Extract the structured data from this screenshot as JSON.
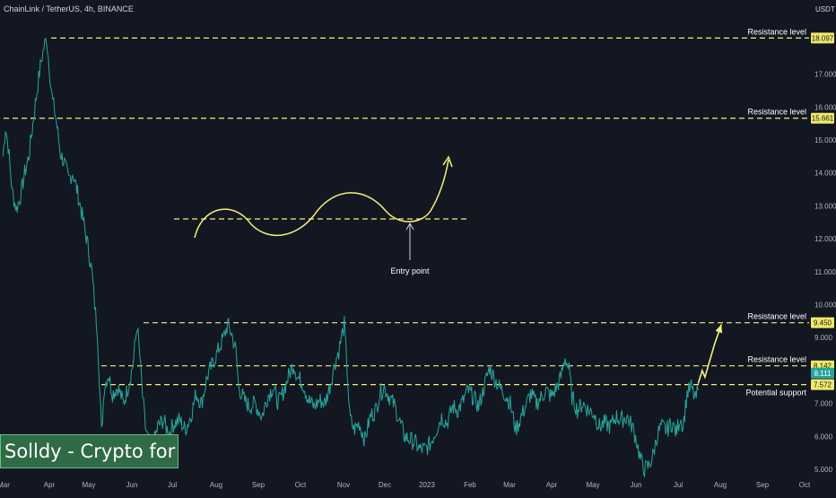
{
  "header": {
    "symbol_text": "ChainLink / TetherUS, 4h, BINANCE",
    "currency": "USDT"
  },
  "watermark": {
    "text": "Solldy - Crypto for U"
  },
  "colors": {
    "background": "#131722",
    "price_line": "#26a69a",
    "annotation": "#f5f07a",
    "axis_text": "#b2b5be",
    "label_text": "#ffffff"
  },
  "chart_data": {
    "type": "line",
    "title": "ChainLink / TetherUS, 4h, BINANCE",
    "ylabel": "USDT",
    "ylim": [
      4.8,
      18.9
    ],
    "y_ticks": [
      "5.000",
      "6.000",
      "7.000",
      "8.000",
      "9.000",
      "10.000",
      "11.000",
      "12.000",
      "13.000",
      "14.000",
      "15.000",
      "16.000",
      "17.000"
    ],
    "x_ticks": [
      "Mar",
      "Apr",
      "May",
      "Jun",
      "Jul",
      "Aug",
      "Sep",
      "Oct",
      "Nov",
      "Dec",
      "2023",
      "Feb",
      "Mar",
      "Apr",
      "May",
      "Jun",
      "Jul",
      "Aug",
      "Sep",
      "Oct"
    ],
    "series": [
      {
        "values": [
          [
            "2022-03-01",
            14.5
          ],
          [
            "2022-03-03",
            15.4
          ],
          [
            "2022-03-05",
            14.8
          ],
          [
            "2022-03-08",
            13.4
          ],
          [
            "2022-03-11",
            12.9
          ],
          [
            "2022-03-14",
            13.3
          ],
          [
            "2022-03-17",
            14.0
          ],
          [
            "2022-03-20",
            14.5
          ],
          [
            "2022-03-23",
            15.5
          ],
          [
            "2022-03-26",
            16.5
          ],
          [
            "2022-03-29",
            17.4
          ],
          [
            "2022-03-31",
            17.8
          ],
          [
            "2022-04-02",
            18.1
          ],
          [
            "2022-04-04",
            17.2
          ],
          [
            "2022-04-06",
            16.3
          ],
          [
            "2022-04-09",
            15.6
          ],
          [
            "2022-04-12",
            14.6
          ],
          [
            "2022-04-15",
            14.3
          ],
          [
            "2022-04-18",
            13.8
          ],
          [
            "2022-04-21",
            14.0
          ],
          [
            "2022-04-24",
            13.5
          ],
          [
            "2022-04-28",
            12.7
          ],
          [
            "2022-05-02",
            11.8
          ],
          [
            "2022-05-05",
            11.0
          ],
          [
            "2022-05-07",
            10.0
          ],
          [
            "2022-05-09",
            9.2
          ],
          [
            "2022-05-11",
            7.2
          ],
          [
            "2022-05-12",
            6.1
          ],
          [
            "2022-05-14",
            7.5
          ],
          [
            "2022-05-17",
            7.9
          ],
          [
            "2022-05-20",
            7.3
          ],
          [
            "2022-05-24",
            7.5
          ],
          [
            "2022-05-28",
            7.0
          ],
          [
            "2022-06-01",
            7.6
          ],
          [
            "2022-06-04",
            8.2
          ],
          [
            "2022-06-07",
            9.4
          ],
          [
            "2022-06-09",
            8.4
          ],
          [
            "2022-06-11",
            7.2
          ],
          [
            "2022-06-13",
            6.3
          ],
          [
            "2022-06-15",
            5.9
          ],
          [
            "2022-06-18",
            5.6
          ],
          [
            "2022-06-22",
            6.3
          ],
          [
            "2022-06-26",
            6.5
          ],
          [
            "2022-06-30",
            6.1
          ],
          [
            "2022-07-04",
            6.4
          ],
          [
            "2022-07-08",
            6.5
          ],
          [
            "2022-07-12",
            6.2
          ],
          [
            "2022-07-16",
            6.6
          ],
          [
            "2022-07-20",
            7.3
          ],
          [
            "2022-07-24",
            7.0
          ],
          [
            "2022-07-28",
            7.8
          ],
          [
            "2022-08-01",
            8.2
          ],
          [
            "2022-08-05",
            8.6
          ],
          [
            "2022-08-09",
            9.0
          ],
          [
            "2022-08-12",
            9.4
          ],
          [
            "2022-08-15",
            9.1
          ],
          [
            "2022-08-18",
            8.6
          ],
          [
            "2022-08-20",
            7.5
          ],
          [
            "2022-08-24",
            7.1
          ],
          [
            "2022-08-28",
            6.9
          ],
          [
            "2022-09-01",
            7.0
          ],
          [
            "2022-09-06",
            6.6
          ],
          [
            "2022-09-10",
            7.2
          ],
          [
            "2022-09-14",
            7.5
          ],
          [
            "2022-09-18",
            7.0
          ],
          [
            "2022-09-22",
            7.4
          ],
          [
            "2022-09-26",
            7.9
          ],
          [
            "2022-09-29",
            8.2
          ],
          [
            "2022-10-02",
            7.8
          ],
          [
            "2022-10-06",
            7.6
          ],
          [
            "2022-10-10",
            7.1
          ],
          [
            "2022-10-14",
            6.9
          ],
          [
            "2022-10-18",
            7.1
          ],
          [
            "2022-10-22",
            7.0
          ],
          [
            "2022-10-26",
            7.6
          ],
          [
            "2022-10-29",
            8.2
          ],
          [
            "2022-11-01",
            8.6
          ],
          [
            "2022-11-03",
            9.0
          ],
          [
            "2022-11-05",
            9.4
          ],
          [
            "2022-11-07",
            8.1
          ],
          [
            "2022-11-09",
            6.6
          ],
          [
            "2022-11-12",
            6.2
          ],
          [
            "2022-11-16",
            6.4
          ],
          [
            "2022-11-20",
            5.9
          ],
          [
            "2022-11-24",
            6.6
          ],
          [
            "2022-11-28",
            6.8
          ],
          [
            "2022-12-01",
            7.3
          ],
          [
            "2022-12-04",
            7.5
          ],
          [
            "2022-12-08",
            7.2
          ],
          [
            "2022-12-12",
            6.9
          ],
          [
            "2022-12-15",
            6.5
          ],
          [
            "2022-12-19",
            6.0
          ],
          [
            "2022-12-23",
            5.9
          ],
          [
            "2022-12-27",
            5.8
          ],
          [
            "2022-12-30",
            5.6
          ],
          [
            "2023-01-03",
            5.6
          ],
          [
            "2023-01-07",
            5.8
          ],
          [
            "2023-01-11",
            6.2
          ],
          [
            "2023-01-15",
            6.6
          ],
          [
            "2023-01-19",
            6.4
          ],
          [
            "2023-01-23",
            6.9
          ],
          [
            "2023-01-27",
            6.8
          ],
          [
            "2023-01-31",
            7.1
          ],
          [
            "2023-02-03",
            7.4
          ],
          [
            "2023-02-07",
            7.2
          ],
          [
            "2023-02-11",
            6.9
          ],
          [
            "2023-02-15",
            7.5
          ],
          [
            "2023-02-19",
            8.1
          ],
          [
            "2023-02-22",
            7.8
          ],
          [
            "2023-02-26",
            7.5
          ],
          [
            "2023-03-02",
            7.3
          ],
          [
            "2023-03-06",
            7.0
          ],
          [
            "2023-03-10",
            6.2
          ],
          [
            "2023-03-13",
            6.5
          ],
          [
            "2023-03-17",
            6.9
          ],
          [
            "2023-03-21",
            7.3
          ],
          [
            "2023-03-25",
            7.0
          ],
          [
            "2023-03-29",
            7.2
          ],
          [
            "2023-04-01",
            7.4
          ],
          [
            "2023-04-05",
            7.2
          ],
          [
            "2023-04-09",
            7.5
          ],
          [
            "2023-04-12",
            7.8
          ],
          [
            "2023-04-15",
            8.4
          ],
          [
            "2023-04-18",
            8.0
          ],
          [
            "2023-04-20",
            7.2
          ],
          [
            "2023-04-24",
            6.8
          ],
          [
            "2023-04-28",
            7.0
          ],
          [
            "2023-05-02",
            6.8
          ],
          [
            "2023-05-06",
            6.7
          ],
          [
            "2023-05-10",
            6.3
          ],
          [
            "2023-05-14",
            6.4
          ],
          [
            "2023-05-18",
            6.3
          ],
          [
            "2023-05-22",
            6.6
          ],
          [
            "2023-05-26",
            6.5
          ],
          [
            "2023-05-30",
            6.6
          ],
          [
            "2023-06-03",
            6.3
          ],
          [
            "2023-06-06",
            5.9
          ],
          [
            "2023-06-09",
            5.3
          ],
          [
            "2023-06-12",
            5.0
          ],
          [
            "2023-06-15",
            5.1
          ],
          [
            "2023-06-18",
            5.4
          ],
          [
            "2023-06-21",
            6.0
          ],
          [
            "2023-06-24",
            6.3
          ],
          [
            "2023-06-28",
            6.2
          ],
          [
            "2023-07-02",
            6.4
          ],
          [
            "2023-07-05",
            6.1
          ],
          [
            "2023-07-08",
            6.6
          ],
          [
            "2023-07-10",
            6.3
          ],
          [
            "2023-07-13",
            7.3
          ],
          [
            "2023-07-16",
            7.5
          ],
          [
            "2023-07-19",
            7.1
          ],
          [
            "2023-07-21",
            7.4
          ]
        ]
      }
    ],
    "horizontal_levels": [
      {
        "label": "Resistance level",
        "value": 18.097,
        "tag": "18.097"
      },
      {
        "label": "Resistance level",
        "value": 15.661,
        "tag": "15.661"
      },
      {
        "label": "Resistance level",
        "value": 9.45,
        "tag": "9.450"
      },
      {
        "label": "Resistance level",
        "value": 8.142,
        "tag": "8.142"
      },
      {
        "label": "Potential support",
        "value": 7.572,
        "tag": "7.572"
      }
    ],
    "current_price_tag": "8.111",
    "annotations": [
      {
        "text": "Entry point"
      }
    ],
    "projection_path": [
      [
        "2023-07-21",
        7.6
      ],
      [
        "2023-07-24",
        8.0
      ],
      [
        "2023-07-26",
        7.8
      ],
      [
        "2023-08-02",
        8.8
      ],
      [
        "2023-08-07",
        9.4
      ]
    ],
    "grid": false
  }
}
